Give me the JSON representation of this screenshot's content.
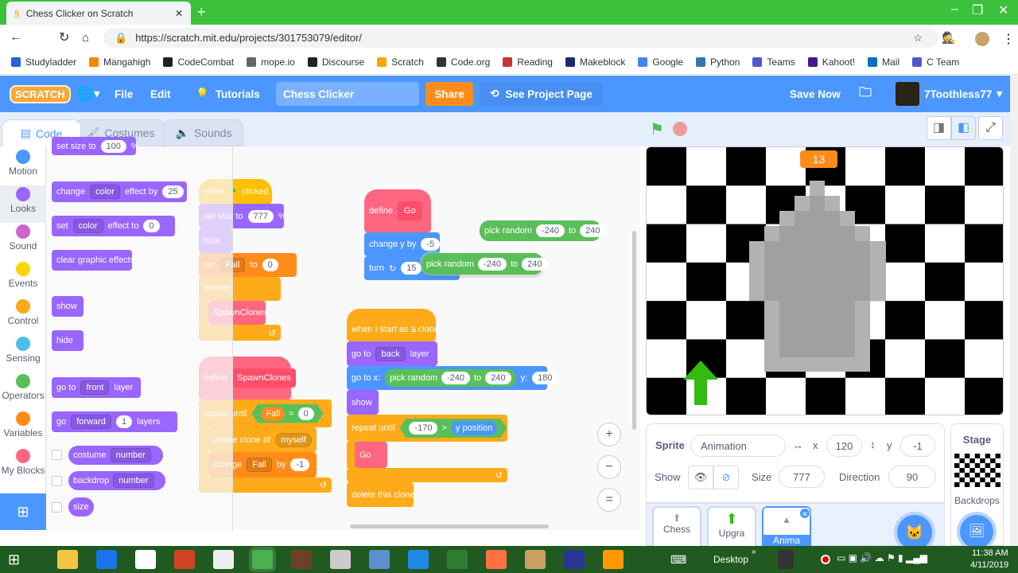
{
  "browser": {
    "tab_title": "Chess Clicker on Scratch",
    "url": "https://scratch.mit.edu/projects/301753079/editor/",
    "bookmarks": [
      "Studyladder",
      "Mangahigh",
      "CodeCombat",
      "mope.io",
      "Discourse",
      "Scratch",
      "Code.org",
      "Reading",
      "Makeblock",
      "Google",
      "Python",
      "Teams",
      "Kahoot!",
      "Mail",
      "C Team"
    ],
    "bookmark_colors": [
      "#2b5fd9",
      "#f08a00",
      "#222",
      "#666",
      "#222",
      "#f6a800",
      "#333",
      "#c33",
      "#1a2a6c",
      "#4285f4",
      "#3776ab",
      "#5059c9",
      "#46178f",
      "#0072c6",
      "#5059c9"
    ]
  },
  "menu": {
    "logo": "SCRATCH",
    "file": "File",
    "edit": "Edit",
    "tutorials": "Tutorials",
    "project_title": "Chess Clicker",
    "share": "Share",
    "see_project": "See Project Page",
    "save_now": "Save Now",
    "username": "7Toothless77"
  },
  "editor_tabs": {
    "code": "Code",
    "costumes": "Costumes",
    "sounds": "Sounds"
  },
  "categories": [
    {
      "label": "Motion",
      "color": "#4c97ff"
    },
    {
      "label": "Looks",
      "color": "#9966ff"
    },
    {
      "label": "Sound",
      "color": "#cf63cf"
    },
    {
      "label": "Events",
      "color": "#ffd500"
    },
    {
      "label": "Control",
      "color": "#ffab19"
    },
    {
      "label": "Sensing",
      "color": "#4cbfe6"
    },
    {
      "label": "Operators",
      "color": "#59c059"
    },
    {
      "label": "Variables",
      "color": "#ff8c1a"
    },
    {
      "label": "My Blocks",
      "color": "#ff6680"
    }
  ],
  "palette": {
    "set_size": [
      "set size to",
      "100",
      "%"
    ],
    "change_effect": [
      "change",
      "color",
      "effect by",
      "25"
    ],
    "set_effect": [
      "set",
      "color",
      "effect to",
      "0"
    ],
    "clear": "clear graphic effects",
    "show": "show",
    "hide": "hide",
    "goto_layer": [
      "go to",
      "front",
      "layer"
    ],
    "go_layers": [
      "go",
      "forward",
      "1",
      "layers"
    ],
    "costume": [
      "costume",
      "number"
    ],
    "backdrop": [
      "backdrop",
      "number"
    ],
    "size": "size"
  },
  "scripts": {
    "flag": {
      "when": "when",
      "clicked": "clicked",
      "set_size": [
        "set size to",
        "777",
        "%"
      ],
      "hide": "hide",
      "set_var": [
        "set",
        "Fall",
        "to",
        "0"
      ],
      "forever": "forever",
      "call": "SpawnClones"
    },
    "spawn": {
      "define": "define",
      "name": "SpawnClones",
      "repeat": "repeat until",
      "var": "Fall",
      "eq": "=",
      "val": "0",
      "create": "create clone of",
      "myself": "myself",
      "change": [
        "change",
        "Fall",
        "by",
        "-1"
      ]
    },
    "go": {
      "define": "define",
      "name": "Go",
      "change_y": [
        "change y by",
        "-5"
      ],
      "turn": [
        "turn",
        "15"
      ],
      "random": [
        "pick random",
        "-240",
        "to",
        "240"
      ]
    },
    "loose_random": [
      "pick random",
      "-240",
      "to",
      "240"
    ],
    "clone": {
      "hat": "when I start as a clone",
      "goto_layer": [
        "go to",
        "back",
        "layer"
      ],
      "goto_xy": [
        "go to x:",
        "pick random",
        "-240",
        "to",
        "240",
        "y:",
        "180"
      ],
      "show": "show",
      "repeat": [
        "repeat until",
        "-170",
        ">",
        "y position"
      ],
      "call": "Go",
      "delete": "delete this clone"
    }
  },
  "zoom": {
    "in": "+",
    "out": "−",
    "reset": "="
  },
  "stage": {
    "counter": "13",
    "counter_color": "#ff8c1a"
  },
  "sprite_info": {
    "sprite_label": "Sprite",
    "sprite_name": "Animation",
    "x_label": "x",
    "x": "120",
    "y_label": "y",
    "y": "-1",
    "show_label": "Show",
    "size_label": "Size",
    "size": "777",
    "direction_label": "Direction",
    "direction": "90"
  },
  "sprites": [
    "Chess",
    "Upgra",
    "Anima"
  ],
  "stage_panel": {
    "title": "Stage",
    "backdrops": "Backdrops"
  },
  "taskbar": {
    "desktop": "Desktop",
    "chevron": "»",
    "time": "11:38 AM",
    "date": "4/11/2019"
  }
}
